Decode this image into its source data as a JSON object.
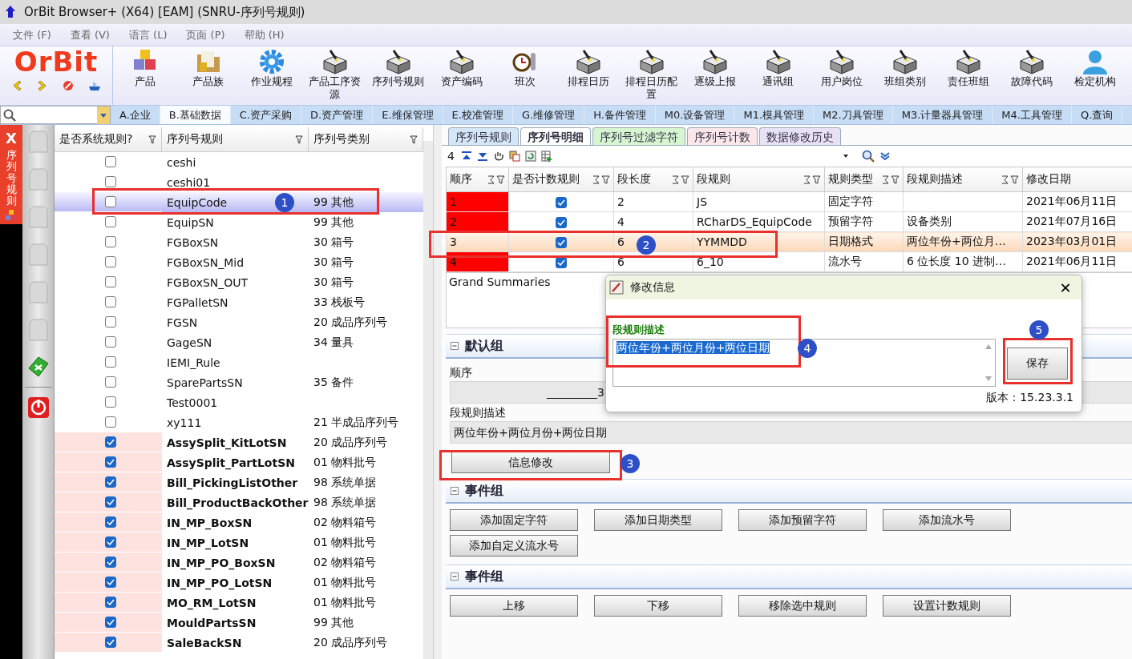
{
  "window": {
    "title": "OrBit Browser+ (X64) [EAM] (SNRU-序列号规则)"
  },
  "menu": [
    "文件 (F)",
    "查看 (V)",
    "语言 (L)",
    "页面 (P)",
    "帮助 (H)"
  ],
  "logo": "OrBit",
  "toolbar": [
    {
      "label": "产品",
      "kind": "cubes"
    },
    {
      "label": "产品族",
      "kind": "folder"
    },
    {
      "label": "作业规程",
      "kind": "gear"
    },
    {
      "label": "产品工序资源",
      "kind": "machine"
    },
    {
      "label": "序列号规则",
      "kind": "machine"
    },
    {
      "label": "资产编码",
      "kind": "machine"
    },
    {
      "label": "班次",
      "kind": "clock"
    },
    {
      "label": "排程日历",
      "kind": "machine"
    },
    {
      "label": "排程日历配置",
      "kind": "machine"
    },
    {
      "label": "逐级上报",
      "kind": "machine"
    },
    {
      "label": "通讯组",
      "kind": "machine"
    },
    {
      "label": "用户岗位",
      "kind": "machine"
    },
    {
      "label": "班组类别",
      "kind": "machine"
    },
    {
      "label": "责任班组",
      "kind": "machine"
    },
    {
      "label": "故障代码",
      "kind": "machine"
    },
    {
      "label": "检定机构",
      "kind": "person"
    }
  ],
  "modules": [
    {
      "label": "A.企业",
      "selected": false
    },
    {
      "label": "B.基础数据",
      "selected": true
    },
    {
      "label": "C.资产采购",
      "selected": false
    },
    {
      "label": "D.资产管理",
      "selected": false
    },
    {
      "label": "E.维保管理",
      "selected": false
    },
    {
      "label": "E.校准管理",
      "selected": false
    },
    {
      "label": "G.维修管理",
      "selected": false
    },
    {
      "label": "H.备件管理",
      "selected": false
    },
    {
      "label": "M0.设备管理",
      "selected": false
    },
    {
      "label": "M1.模具管理",
      "selected": false
    },
    {
      "label": "M2.刀具管理",
      "selected": false
    },
    {
      "label": "M3.计量器具管理",
      "selected": false
    },
    {
      "label": "M4.工具管理",
      "selected": false
    },
    {
      "label": "Q.查询",
      "selected": false
    }
  ],
  "side_tab": {
    "close": "X",
    "title": "序列号规则"
  },
  "rule_list": {
    "columns": [
      "是否系统规则?",
      "序列号规则",
      "序列号类别"
    ],
    "rows": [
      {
        "system": false,
        "rule": "ceshi",
        "category": "",
        "selected": false
      },
      {
        "system": false,
        "rule": "ceshi01",
        "category": "",
        "selected": false
      },
      {
        "system": false,
        "rule": "EquipCode",
        "category": "99 其他",
        "selected": true
      },
      {
        "system": false,
        "rule": "EquipSN",
        "category": "99 其他",
        "selected": false
      },
      {
        "system": false,
        "rule": "FGBoxSN",
        "category": "30 箱号",
        "selected": false
      },
      {
        "system": false,
        "rule": "FGBoxSN_Mid",
        "category": "30 箱号",
        "selected": false
      },
      {
        "system": false,
        "rule": "FGBoxSN_OUT",
        "category": "30 箱号",
        "selected": false
      },
      {
        "system": false,
        "rule": "FGPalletSN",
        "category": "33 栈板号",
        "selected": false
      },
      {
        "system": false,
        "rule": "FGSN",
        "category": "20 成品序列号",
        "selected": false
      },
      {
        "system": false,
        "rule": "GageSN",
        "category": "34 量具",
        "selected": false
      },
      {
        "system": false,
        "rule": "IEMI_Rule",
        "category": "",
        "selected": false
      },
      {
        "system": false,
        "rule": "SparePartsSN",
        "category": "35 备件",
        "selected": false
      },
      {
        "system": false,
        "rule": "Test0001",
        "category": "",
        "selected": false
      },
      {
        "system": false,
        "rule": "xy111",
        "category": "21 半成品序列号",
        "selected": false
      },
      {
        "system": true,
        "rule": "AssySplit_KitLotSN",
        "category": "20 成品序列号",
        "selected": false
      },
      {
        "system": true,
        "rule": "AssySplit_PartLotSN",
        "category": "01 物料批号",
        "selected": false
      },
      {
        "system": true,
        "rule": "Bill_PickingListOther",
        "category": "98 系统单据",
        "selected": false
      },
      {
        "system": true,
        "rule": "Bill_ProductBackOther",
        "category": "98 系统单据",
        "selected": false
      },
      {
        "system": true,
        "rule": "IN_MP_BoxSN",
        "category": "02 物料箱号",
        "selected": false
      },
      {
        "system": true,
        "rule": "IN_MP_LotSN",
        "category": "01 物料批号",
        "selected": false
      },
      {
        "system": true,
        "rule": "IN_MP_PO_BoxSN",
        "category": "02 物料箱号",
        "selected": false
      },
      {
        "system": true,
        "rule": "IN_MP_PO_LotSN",
        "category": "01 物料批号",
        "selected": false
      },
      {
        "system": true,
        "rule": "MO_RM_LotSN",
        "category": "01 物料批号",
        "selected": false
      },
      {
        "system": true,
        "rule": "MouldPartsSN",
        "category": "99 其他",
        "selected": false
      },
      {
        "system": true,
        "rule": "SaleBackSN",
        "category": "20 成品序列号",
        "selected": false
      }
    ]
  },
  "detail_tabs": [
    {
      "label": "序列号规则",
      "selected": false,
      "color": "#d4e6f8"
    },
    {
      "label": "序列号明细",
      "selected": true,
      "color": "#ffffff"
    },
    {
      "label": "序列号过滤字符",
      "selected": false,
      "color": "#d8f5d2"
    },
    {
      "label": "序列号计数",
      "selected": false,
      "color": "#fbe6ea"
    },
    {
      "label": "数据修改历史",
      "selected": false,
      "color": "#e8e2f6"
    }
  ],
  "detail_toolbar": {
    "count": "4"
  },
  "segments": {
    "columns": [
      "顺序",
      "是否计数规则",
      "段长度",
      "段规则",
      "规则类型",
      "段规则描述",
      "修改日期"
    ],
    "rows": [
      {
        "seq": "1",
        "marked": true,
        "counted": true,
        "length": "2",
        "rule": "JS",
        "type": "固定字符",
        "desc": "",
        "date": "2021年06月11日",
        "selected": false
      },
      {
        "seq": "2",
        "marked": true,
        "counted": true,
        "length": "4",
        "rule": "RCharDS_EquipCode",
        "type": "预留字符",
        "desc": "设备类别",
        "date": "2021年07月16日",
        "selected": false
      },
      {
        "seq": "3",
        "marked": false,
        "counted": true,
        "length": "6",
        "rule": "YYMMDD",
        "type": "日期格式",
        "desc": "两位年份+两位月…",
        "date": "2023年03月01日",
        "selected": true
      },
      {
        "seq": "4",
        "marked": true,
        "counted": true,
        "length": "6",
        "rule": "6_10",
        "type": "流水号",
        "desc": "6 位长度 10 进制…",
        "date": "2021年06月11日",
        "selected": false
      }
    ],
    "summary": "Grand Summaries"
  },
  "default_group": {
    "title": "默认组",
    "fields": [
      {
        "label": "顺序",
        "value": "_________3"
      },
      {
        "label": "段规则描述",
        "value": "两位年份+两位月份+两位日期"
      }
    ],
    "button": "信息修改"
  },
  "event_groups": [
    {
      "title": "事件组",
      "buttons": [
        "添加固定字符",
        "添加日期类型",
        "添加预留字符",
        "添加流水号",
        "添加自定义流水号"
      ]
    },
    {
      "title": "事件组",
      "buttons": [
        "上移",
        "下移",
        "移除选中规则",
        "设置计数规则"
      ]
    }
  ],
  "dialog": {
    "title": "修改信息",
    "close": "✕",
    "label": "段规则描述",
    "value": "两位年份+两位月份+两位日期",
    "save": "保存",
    "version": "版本：15.23.3.1"
  },
  "annotations": [
    {
      "number": "1"
    },
    {
      "number": "2"
    },
    {
      "number": "3"
    },
    {
      "number": "4"
    },
    {
      "number": "5"
    }
  ]
}
